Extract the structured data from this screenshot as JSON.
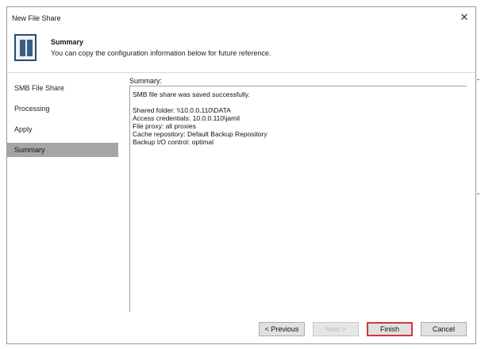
{
  "window": {
    "title": "New File Share"
  },
  "header": {
    "title": "Summary",
    "subtitle": "You can copy the configuration information below for future reference."
  },
  "sidebar": {
    "items": [
      {
        "label": "SMB File Share",
        "active": false
      },
      {
        "label": "Processing",
        "active": false
      },
      {
        "label": "Apply",
        "active": false
      },
      {
        "label": "Summary",
        "active": true
      }
    ]
  },
  "content": {
    "label": "Summary:",
    "lines": [
      "SMB file share was saved successfully.",
      "",
      "Shared folder: \\\\10.0.0.110\\DATA",
      "Access credentials: 10.0.0.110\\jamil",
      "File proxy: all proxies",
      "Cache repository: Default Backup Repository",
      "Backup I/O control: optimal"
    ]
  },
  "buttons": {
    "previous": "< Previous",
    "next": "Next >",
    "finish": "Finish",
    "cancel": "Cancel"
  },
  "colors": {
    "active_nav": "#a5a5a5",
    "finish_highlight": "#d0393b"
  }
}
